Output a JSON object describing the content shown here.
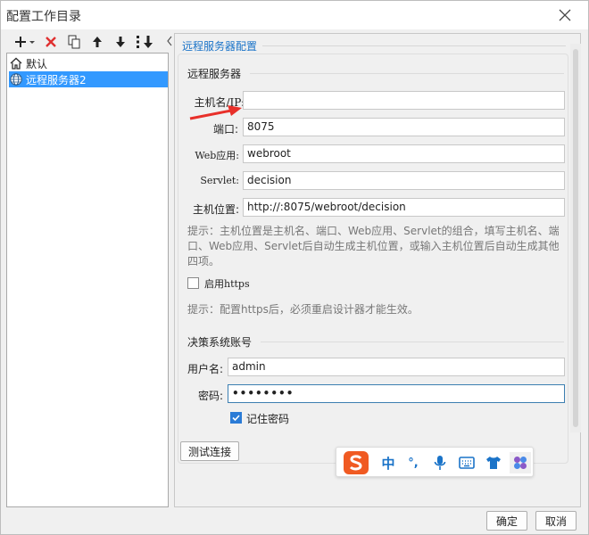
{
  "window": {
    "title": "配置工作目录"
  },
  "tree": {
    "items": [
      {
        "label": "默认",
        "icon": "home-icon"
      },
      {
        "label": "远程服务器2",
        "icon": "globe-icon"
      }
    ]
  },
  "panel": {
    "title": "远程服务器配置",
    "server_group": {
      "title": "远程服务器",
      "host_label": "主机名/IP:",
      "host_value": "",
      "port_label": "端口:",
      "port_value": "8075",
      "web_label": "Web应用:",
      "web_value": "webroot",
      "servlet_label": "Servlet:",
      "servlet_value": "decision",
      "location_label": "主机位置:",
      "location_value": "http://:8075/webroot/decision",
      "hint1": "提示：主机位置是主机名、端口、Web应用、Servlet的组合，填写主机名、端口、Web应用、Servlet后自动生成主机位置，或输入主机位置后自动生成其他四项。",
      "https_label": "启用https",
      "https_checked": false,
      "hint2": "提示：配置https后，必须重启设计器才能生效。"
    },
    "account_group": {
      "title": "决策系统账号",
      "user_label": "用户名:",
      "user_value": "admin",
      "password_label": "密码:",
      "password_value": "••••••••",
      "remember_label": "记住密码",
      "remember_checked": true
    },
    "test_button": "测试连接"
  },
  "ime": {
    "lang": "中",
    "punct": "°,"
  },
  "footer": {
    "ok": "确定",
    "cancel": "取消"
  },
  "colors": {
    "accent": "#3399ff",
    "section_title": "#1a73c8",
    "arrow": "#e8302a",
    "sogou": "#f05a22"
  }
}
